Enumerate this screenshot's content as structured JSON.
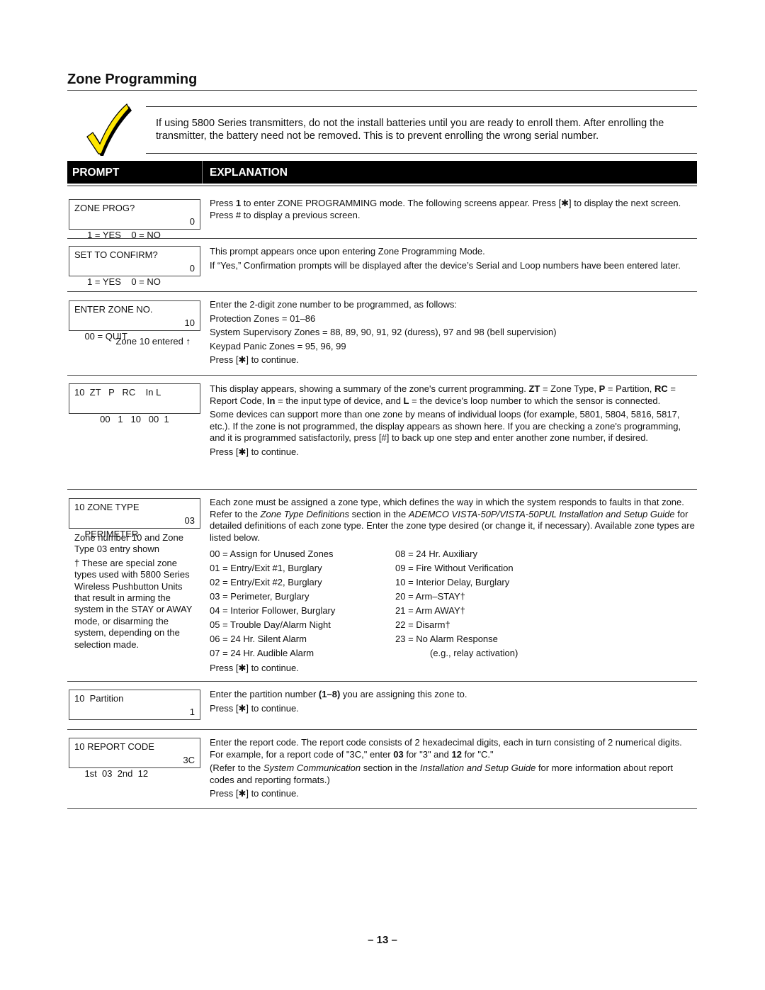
{
  "page": {
    "title": "Zone Programming",
    "page_number": "– 13 –"
  },
  "note": {
    "icon": "checkmark-icon",
    "icon_color": "#FFE600",
    "text": "If using 5800 Series transmitters, do not the install batteries until you are ready to enroll them. After enrolling the transmitter, the battery need not be removed. This is to prevent enrolling the wrong serial number."
  },
  "table_header": {
    "prompt": "PROMPT",
    "explanation": "EXPLANATION"
  },
  "rows": [
    {
      "lcd": {
        "line1": "ZONE PROG?",
        "line2_left": " 1 = YES    0 = NO",
        "line2_right": "0"
      },
      "explanation": {
        "p1_a": "Press ",
        "p1_b": "1",
        "p1_c": " to enter ZONE PROGRAMMING mode. The following screens appear. Press [✱] to display the next screen. Press # to display a previous screen."
      }
    },
    {
      "lcd": {
        "line1": "SET TO CONFIRM?",
        "line2_left": " 1 = YES    0 = NO",
        "line2_right": "0"
      },
      "explanation": {
        "p1": "This prompt appears once upon entering Zone Programming Mode.",
        "p2": "If “Yes,” Confirmation prompts will be displayed after the device’s Serial and Loop numbers have been entered later."
      }
    },
    {
      "lcd": {
        "line1": "ENTER ZONE NO.",
        "line2_left": "00 = QUIT",
        "line2_right": "10"
      },
      "caption": "Zone 10 entered ↑",
      "explanation": {
        "p1": "Enter the 2-digit zone number to be programmed, as follows:",
        "p2": "Protection Zones = 01–86",
        "p3": "System Supervisory Zones = 88, 89, 90, 91, 92 (duress), 97 and 98 (bell supervision)",
        "p4": "Keypad Panic Zones = 95, 96, 99",
        "p5": "Press [✱] to continue."
      }
    },
    {
      "lcd": {
        "line1": "10  ZT   P   RC    In L",
        "line2_left": "      00   1   10   00  1",
        "line2_right": ""
      },
      "explanation": {
        "p1_a": "This display appears, showing a summary of the zone's current programming.  ",
        "p1_zt": "ZT",
        "p1_b": " = Zone Type, ",
        "p1_p": "P",
        "p1_c": " = Partition, ",
        "p1_rc": "RC",
        "p1_d": " = Report Code, ",
        "p1_in": "In",
        "p1_e": " = the input type of device, and ",
        "p1_l": "L",
        "p1_f": " = the device's loop number to which the sensor is connected.",
        "p2": "Some devices can support more than one zone by means of individual loops (for example, 5801, 5804, 5816, 5817, etc.).  If the zone is not programmed, the display appears as shown here.  If you are checking a zone's programming, and it is programmed satisfactorily, press [#] to back up one step and enter another zone number, if desired.",
        "p3": "Press [✱] to continue."
      }
    },
    {
      "lcd": {
        "line1": "10 ZONE TYPE",
        "line2_left": "PERIMETER",
        "line2_right": "03"
      },
      "side_note": {
        "p1": "Zone number 10 and Zone Type 03 entry shown",
        "p2": "†   These are special zone types used with 5800 Series Wireless Pushbutton Units that result in arming the system in the STAY or AWAY mode, or disarming the system, depending on the selection made."
      },
      "explanation": {
        "p1_a": "Each zone must be assigned a zone type, which defines the way in which the system responds to faults in that zone.  Refer to the ",
        "p1_i1": "Zone Type Definitions",
        "p1_b": " section in the ",
        "p1_i2": "ADEMCO VISTA-50P/VISTA-50PUL Installation and Setup Guide",
        "p1_c": " for detailed definitions of each zone type.  Enter the zone type desired (or change it, if necessary).  Available zone types are listed below.",
        "continue": "Press [✱] to continue."
      },
      "zone_types_left": [
        "00 = Assign for Unused Zones",
        "01 = Entry/Exit #1, Burglary",
        "02 = Entry/Exit #2, Burglary",
        "03 = Perimeter, Burglary",
        "04 = Interior Follower, Burglary",
        "05 = Trouble Day/Alarm Night",
        "06 = 24 Hr. Silent Alarm",
        "07 = 24 Hr. Audible Alarm"
      ],
      "zone_types_right": [
        "08 = 24 Hr. Auxiliary",
        "09 = Fire Without Verification",
        "10 = Interior Delay, Burglary",
        "20 = Arm–STAY†",
        "21 = Arm AWAY†",
        "22 = Disarm†",
        "23 = No Alarm Response",
        "(e.g., relay activation)"
      ]
    },
    {
      "lcd": {
        "line1": "10  Partition",
        "line2_left": "",
        "line2_right": "1"
      },
      "explanation": {
        "p1_a": "Enter the partition number ",
        "p1_b": "(1–8)",
        "p1_c": " you are assigning this zone to.",
        "p2": "Press [✱] to continue."
      }
    },
    {
      "lcd": {
        "line1": "10 REPORT CODE",
        "line2_left": "1st  03  2nd  12",
        "line2_right": "3C"
      },
      "explanation": {
        "p1_a": "Enter the report code. The report code consists of 2 hexadecimal digits, each in turn consisting of 2 numerical digits. For example, for a report code of \"3C,\" enter ",
        "p1_b": "03",
        "p1_c": " for \"3\" and ",
        "p1_d": "12",
        "p1_e": " for \"C.\"",
        "p2_a": "(Refer to the ",
        "p2_i1": "System Communication",
        "p2_b": " section in the ",
        "p2_i2": "Installation and Setup Guide",
        "p2_c": " for more information about report codes and reporting formats.)",
        "p3": "Press [✱] to continue."
      }
    }
  ]
}
